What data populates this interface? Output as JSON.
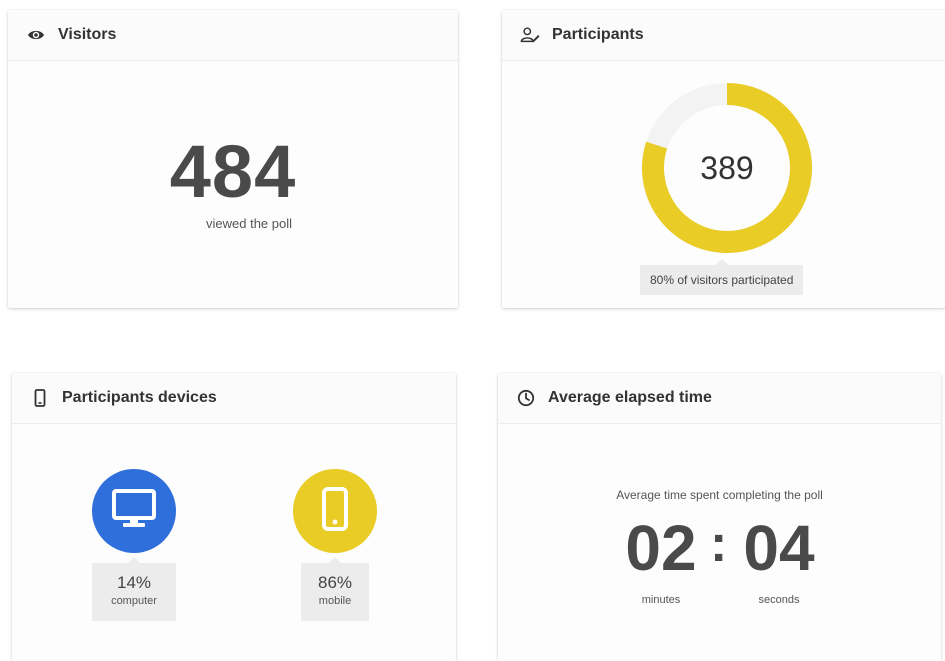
{
  "visitors": {
    "title": "Visitors",
    "icon": "eye-icon",
    "count": "484",
    "caption": "viewed the poll"
  },
  "participants": {
    "title": "Participants",
    "icon": "user-edit-icon",
    "count": "389",
    "participation_fraction": 0.8,
    "caption": "80% of visitors participated",
    "ring_color": "#e9cc25",
    "track_color": "#f3f3f3"
  },
  "devices": {
    "title": "Participants devices",
    "icon": "mobile-phone-icon",
    "items": [
      {
        "name": "computer",
        "percent": "14%",
        "icon": "desktop-monitor-icon",
        "color": "#2f6fdb"
      },
      {
        "name": "mobile",
        "percent": "86%",
        "icon": "smartphone-icon",
        "color": "#e9cc25"
      }
    ]
  },
  "elapsed_time": {
    "title": "Average elapsed time",
    "icon": "clock-icon",
    "caption": "Average time spent completing the poll",
    "minutes": "02",
    "separator": ":",
    "seconds": "04",
    "minutes_label": "minutes",
    "seconds_label": "seconds"
  }
}
